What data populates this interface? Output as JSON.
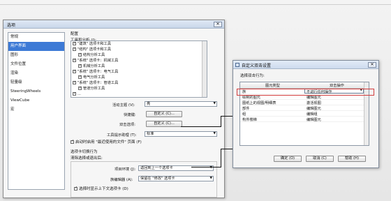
{
  "main_dialog": {
    "title": "选项",
    "close": "✕",
    "nav_items": [
      "常规",
      "用户界面",
      "图形",
      "文件位置",
      "渲染",
      "轻量级",
      "SteeringWheels",
      "ViewCube",
      "宏"
    ],
    "nav_selected": "用户界面",
    "config_label": "配置",
    "tools_label": "工具和分析 (I):",
    "tree_rows": [
      {
        "text": "\"建筑\" 选项卡和工具",
        "checked": true,
        "indent": 0
      },
      {
        "text": "\"结构\" 选项卡和工具",
        "checked": true,
        "indent": 0
      },
      {
        "text": "结构分析工具",
        "checked": true,
        "indent": 1
      },
      {
        "text": "\"系统\" 选项卡：机械工具",
        "checked": true,
        "indent": 0
      },
      {
        "text": "机械分析工具",
        "checked": true,
        "indent": 1
      },
      {
        "text": "\"系统\" 选项卡：电气工具",
        "checked": true,
        "indent": 0
      },
      {
        "text": "电气分析工具",
        "checked": true,
        "indent": 1
      },
      {
        "text": "\"系统\" 选项卡：管道工具",
        "checked": true,
        "indent": 0
      },
      {
        "text": "管道分析工具",
        "checked": true,
        "indent": 1
      },
      {
        "text": "...",
        "checked": true,
        "indent": 0
      }
    ],
    "theme_label": "活动主题 (V):",
    "theme_value": "亮",
    "shortcut_label": "快捷键:",
    "shortcut_button": "自定义 (C)...",
    "dblclick_label": "双击选项:",
    "dblclick_button": "自定义 (C)...",
    "tooltip_label": "工具提示助理 (T):",
    "tooltip_value": "标准",
    "recent_files": "启动时启用 \"最近使用的文件\" 页面 (F)",
    "tab_switch_label": "选项卡切换行为",
    "tab_switch_sub": "清除选择或退出后:",
    "project_env_label": "项目环境 (J):",
    "project_env_value": "返回到上一个选项卡",
    "family_editor_label": "族编辑器 (A):",
    "family_editor_value": "保留在 \"修改\" 选项卡",
    "contextual_tab": "选择时显示上下文选项卡 (D)"
  },
  "custom_dialog": {
    "title": "自定义双击设置",
    "close": "✕",
    "prompt": "选择双击行为:",
    "col_element": "图元类型",
    "col_action": "双击操作",
    "rows": [
      {
        "element": "族",
        "action": "不进行任何操作",
        "selected": true
      },
      {
        "element": "绘制的图元",
        "action": "编辑图元"
      },
      {
        "element": "图纸上的视图/明细表",
        "action": "激活视图"
      },
      {
        "element": "部件",
        "action": "编辑图元"
      },
      {
        "element": "组",
        "action": "编辑组"
      },
      {
        "element": "构件楼梯",
        "action": "编辑图元"
      }
    ],
    "ok": "确定 (O)",
    "cancel": "取消 (C)",
    "help": "帮助 (H)"
  },
  "colors": {
    "selection": "#3d7ad6",
    "highlight": "#d23c3c"
  }
}
